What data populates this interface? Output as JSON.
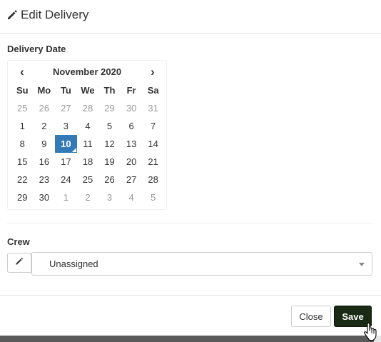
{
  "modal": {
    "title": "Edit Delivery",
    "title_icon": "pencil-icon"
  },
  "delivery_date": {
    "label": "Delivery Date",
    "calendar": {
      "prev": "‹",
      "next": "›",
      "month_label": "November 2020",
      "weekdays": [
        "Su",
        "Mo",
        "Tu",
        "We",
        "Th",
        "Fr",
        "Sa"
      ],
      "weeks": [
        [
          {
            "d": "25",
            "m": "old"
          },
          {
            "d": "26",
            "m": "old"
          },
          {
            "d": "27",
            "m": "old"
          },
          {
            "d": "28",
            "m": "old"
          },
          {
            "d": "29",
            "m": "old"
          },
          {
            "d": "30",
            "m": "old"
          },
          {
            "d": "31",
            "m": "old"
          }
        ],
        [
          {
            "d": "1",
            "m": "cur"
          },
          {
            "d": "2",
            "m": "cur"
          },
          {
            "d": "3",
            "m": "cur"
          },
          {
            "d": "4",
            "m": "cur"
          },
          {
            "d": "5",
            "m": "cur"
          },
          {
            "d": "6",
            "m": "cur"
          },
          {
            "d": "7",
            "m": "cur"
          }
        ],
        [
          {
            "d": "8",
            "m": "cur"
          },
          {
            "d": "9",
            "m": "cur"
          },
          {
            "d": "10",
            "m": "cur",
            "selected": true
          },
          {
            "d": "11",
            "m": "cur"
          },
          {
            "d": "12",
            "m": "cur"
          },
          {
            "d": "13",
            "m": "cur"
          },
          {
            "d": "14",
            "m": "cur"
          }
        ],
        [
          {
            "d": "15",
            "m": "cur"
          },
          {
            "d": "16",
            "m": "cur"
          },
          {
            "d": "17",
            "m": "cur"
          },
          {
            "d": "18",
            "m": "cur"
          },
          {
            "d": "19",
            "m": "cur"
          },
          {
            "d": "20",
            "m": "cur"
          },
          {
            "d": "21",
            "m": "cur"
          }
        ],
        [
          {
            "d": "22",
            "m": "cur"
          },
          {
            "d": "23",
            "m": "cur"
          },
          {
            "d": "24",
            "m": "cur"
          },
          {
            "d": "25",
            "m": "cur"
          },
          {
            "d": "26",
            "m": "cur"
          },
          {
            "d": "27",
            "m": "cur"
          },
          {
            "d": "28",
            "m": "cur"
          }
        ],
        [
          {
            "d": "29",
            "m": "cur"
          },
          {
            "d": "30",
            "m": "cur"
          },
          {
            "d": "1",
            "m": "new"
          },
          {
            "d": "2",
            "m": "new"
          },
          {
            "d": "3",
            "m": "new"
          },
          {
            "d": "4",
            "m": "new"
          },
          {
            "d": "5",
            "m": "new"
          }
        ]
      ]
    }
  },
  "crew": {
    "label": "Crew",
    "edit_icon": "pencil-icon",
    "selected": "Unassigned"
  },
  "footer": {
    "close_label": "Close",
    "save_label": "Save"
  },
  "colors": {
    "selected_day": "#337ab7",
    "save_button": "#1a2a14"
  }
}
